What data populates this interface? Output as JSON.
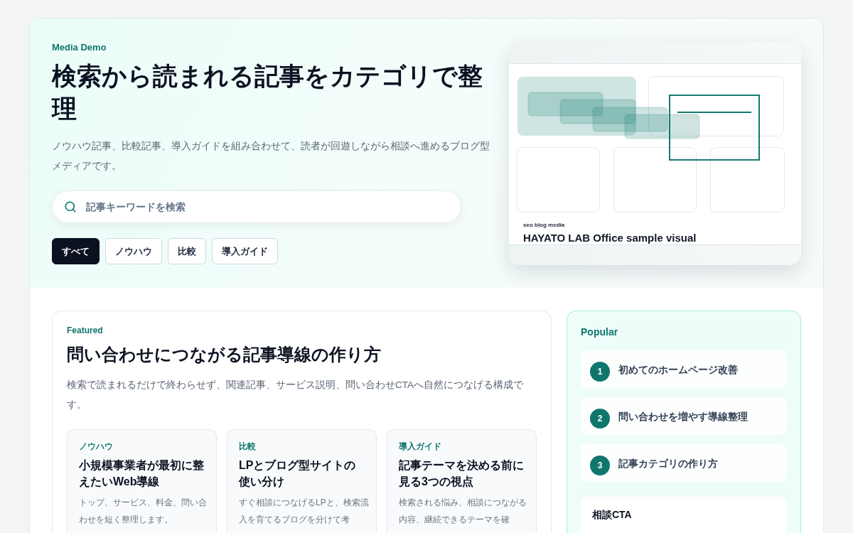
{
  "hero": {
    "eyebrow": "Media Demo",
    "title": "検索から読まれる記事をカテゴリで整理",
    "description": "ノウハウ記事、比較記事、導入ガイドを組み合わせて、読者が回遊しながら相談へ進めるブログ型メディアです。",
    "search": {
      "placeholder": "記事キーワードを検索"
    },
    "filters": [
      {
        "label": "すべて",
        "selected": true
      },
      {
        "label": "ノウハウ",
        "selected": false
      },
      {
        "label": "比較",
        "selected": false
      },
      {
        "label": "導入ガイド",
        "selected": false
      }
    ]
  },
  "hero_visual": {
    "tagline": "seo blog media",
    "caption": "HAYATO LAB Office sample visual"
  },
  "featured": {
    "eyebrow": "Featured",
    "title": "問い合わせにつながる記事導線の作り方",
    "description": "検索で読まれるだけで終わらせず、関連記事、サービス説明、問い合わせCTAへ自然につなげる構成です。",
    "articles": [
      {
        "category": "ノウハウ",
        "title": "小規模事業者が最初に整えたいWeb導線",
        "excerpt": "トップ、サービス、料金、問い合わせを短く整理します。"
      },
      {
        "category": "比較",
        "title": "LPとブログ型サイトの使い分け",
        "excerpt": "すぐ相談につなげるLPと、検索流入を育てるブログを分けて考"
      },
      {
        "category": "導入ガイド",
        "title": "記事テーマを決める前に見る3つの視点",
        "excerpt": "検索される悩み、相談につながる内容、継続できるテーマを確"
      }
    ]
  },
  "popular": {
    "heading": "Popular",
    "items": [
      {
        "rank": "1",
        "title": "初めてのホームページ改善"
      },
      {
        "rank": "2",
        "title": "問い合わせを増やす導線整理"
      },
      {
        "rank": "3",
        "title": "記事カテゴリの作り方"
      }
    ],
    "cta": {
      "heading": "相談CTA"
    }
  }
}
